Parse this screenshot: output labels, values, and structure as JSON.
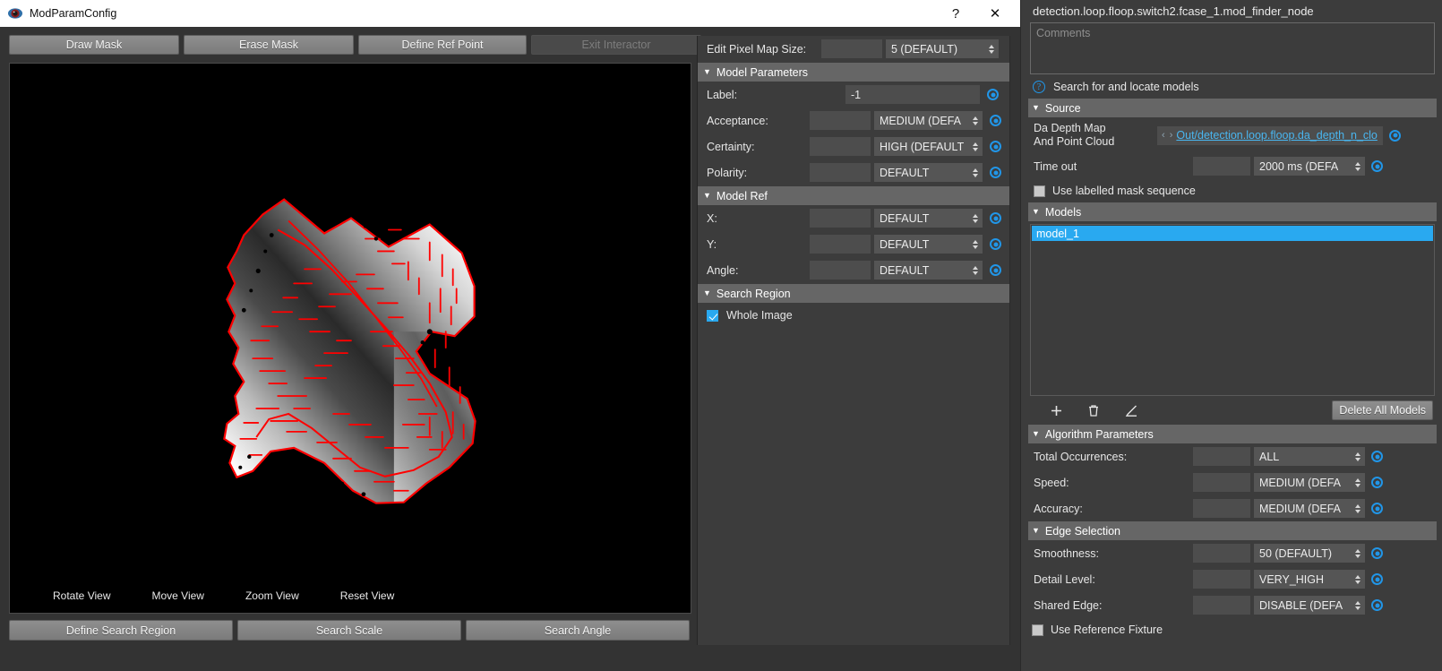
{
  "window": {
    "title": "ModParamConfig",
    "icon": "app-icon",
    "help_button": "?",
    "close_button": "✕"
  },
  "toolbar": {
    "buttons": [
      {
        "label": "Draw Mask",
        "enabled": true
      },
      {
        "label": "Erase Mask",
        "enabled": true
      },
      {
        "label": "Define Ref Point",
        "enabled": true
      },
      {
        "label": "Exit Interactor",
        "enabled": false
      }
    ]
  },
  "viewport": {
    "hints": [
      "Rotate View",
      "Move View",
      "Zoom View",
      "Reset View"
    ],
    "edge_color": "#ff0000",
    "background": "#000000"
  },
  "bottom_toolbar": {
    "buttons": [
      "Define Search Region",
      "Search Scale",
      "Search Angle"
    ]
  },
  "params": {
    "pixel_map": {
      "label": "Edit Pixel Map Size:",
      "value": "",
      "option": "5 (DEFAULT)"
    },
    "model_parameters": {
      "title": "Model Parameters",
      "rows": [
        {
          "label": "Label:",
          "value": "-1",
          "option": null
        },
        {
          "label": "Acceptance:",
          "value": "",
          "option": "MEDIUM (DEFA"
        },
        {
          "label": "Certainty:",
          "value": "",
          "option": "HIGH (DEFAULT"
        },
        {
          "label": "Polarity:",
          "value": "",
          "option": "DEFAULT"
        }
      ]
    },
    "model_ref": {
      "title": "Model Ref",
      "rows": [
        {
          "label": "X:",
          "value": "",
          "option": "DEFAULT"
        },
        {
          "label": "Y:",
          "value": "",
          "option": "DEFAULT"
        },
        {
          "label": "Angle:",
          "value": "",
          "option": "DEFAULT"
        }
      ]
    },
    "search_region": {
      "title": "Search Region",
      "whole_image_label": "Whole Image",
      "whole_image_checked": true
    }
  },
  "right": {
    "node_path": "detection.loop.floop.switch2.fcase_1.mod_finder_node",
    "comments_placeholder": "Comments",
    "help_text": "Search for and locate models",
    "source": {
      "title": "Source",
      "depth_map_label_line1": "Da Depth Map",
      "depth_map_label_line2": "And Point Cloud",
      "depth_map_link": "Out/detection.loop.floop.da_depth_n_clo",
      "nav_arrows": "‹ ›",
      "timeout_label": "Time out",
      "timeout_value": "",
      "timeout_option": "2000 ms (DEFA",
      "masked_label": "Use labelled mask sequence",
      "masked_checked": false
    },
    "models": {
      "title": "Models",
      "items": [
        "model_1"
      ],
      "selected": "model_1",
      "tools": [
        "add-model",
        "delete-model",
        "edit-model"
      ],
      "delete_all_label": "Delete All Models"
    },
    "algorithm": {
      "title": "Algorithm Parameters",
      "rows": [
        {
          "label": "Total Occurrences:",
          "value": "",
          "option": "ALL"
        },
        {
          "label": "Speed:",
          "value": "",
          "option": "MEDIUM (DEFA"
        },
        {
          "label": "Accuracy:",
          "value": "",
          "option": "MEDIUM (DEFA"
        }
      ]
    },
    "edge_selection": {
      "title": "Edge Selection",
      "rows": [
        {
          "label": "Smoothness:",
          "value": "",
          "option": "50 (DEFAULT)"
        },
        {
          "label": "Detail Level:",
          "value": "",
          "option": "VERY_HIGH"
        },
        {
          "label": "Shared Edge:",
          "value": "",
          "option": "DISABLE (DEFA"
        }
      ],
      "ref_fixture_label": "Use Reference Fixture",
      "ref_fixture_checked": false
    }
  },
  "colors": {
    "accent": "#29a9f0",
    "link": "#49b6f0",
    "panel": "#3c3c3c",
    "group_header": "#666666"
  }
}
